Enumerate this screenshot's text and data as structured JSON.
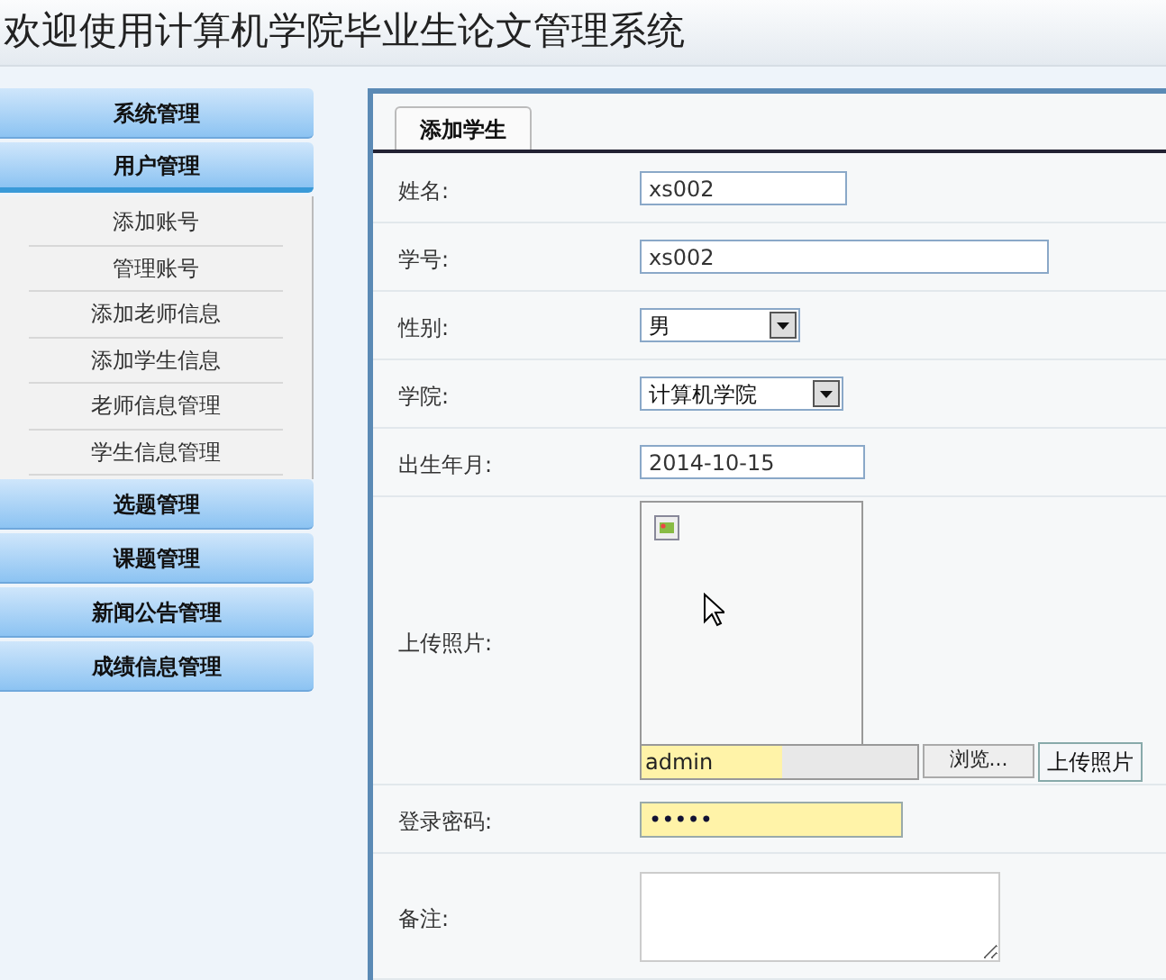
{
  "header": {
    "title": "欢迎使用计算机学院毕业生论文管理系统"
  },
  "sidebar": {
    "groups": [
      {
        "label": "系统管理",
        "expanded": false
      },
      {
        "label": "用户管理",
        "expanded": true,
        "items": [
          {
            "label": "添加账号"
          },
          {
            "label": "管理账号"
          },
          {
            "label": "添加老师信息"
          },
          {
            "label": "添加学生信息"
          },
          {
            "label": "老师信息管理"
          },
          {
            "label": "学生信息管理"
          }
        ]
      },
      {
        "label": "选题管理",
        "expanded": false
      },
      {
        "label": "课题管理",
        "expanded": false
      },
      {
        "label": "新闻公告管理",
        "expanded": false
      },
      {
        "label": "成绩信息管理",
        "expanded": false
      }
    ]
  },
  "tabs": [
    {
      "label": "添加学生",
      "selected": true
    }
  ],
  "form": {
    "fields": [
      {
        "kind": "text",
        "label": "姓名:",
        "value": "xs002"
      },
      {
        "kind": "text",
        "label": "学号:",
        "value": "xs002"
      },
      {
        "kind": "select",
        "label": "性别:",
        "value": "男"
      },
      {
        "kind": "select",
        "label": "学院:",
        "value": "计算机学院"
      },
      {
        "kind": "text",
        "label": "出生年月:",
        "value": "2014-10-15"
      },
      {
        "kind": "photo",
        "label": "上传照片:",
        "value": "admin",
        "browse": "浏览...",
        "upload": "上传照片"
      },
      {
        "kind": "password",
        "label": "登录密码:",
        "value": "•••••"
      },
      {
        "kind": "textarea",
        "label": "备注:"
      }
    ]
  }
}
